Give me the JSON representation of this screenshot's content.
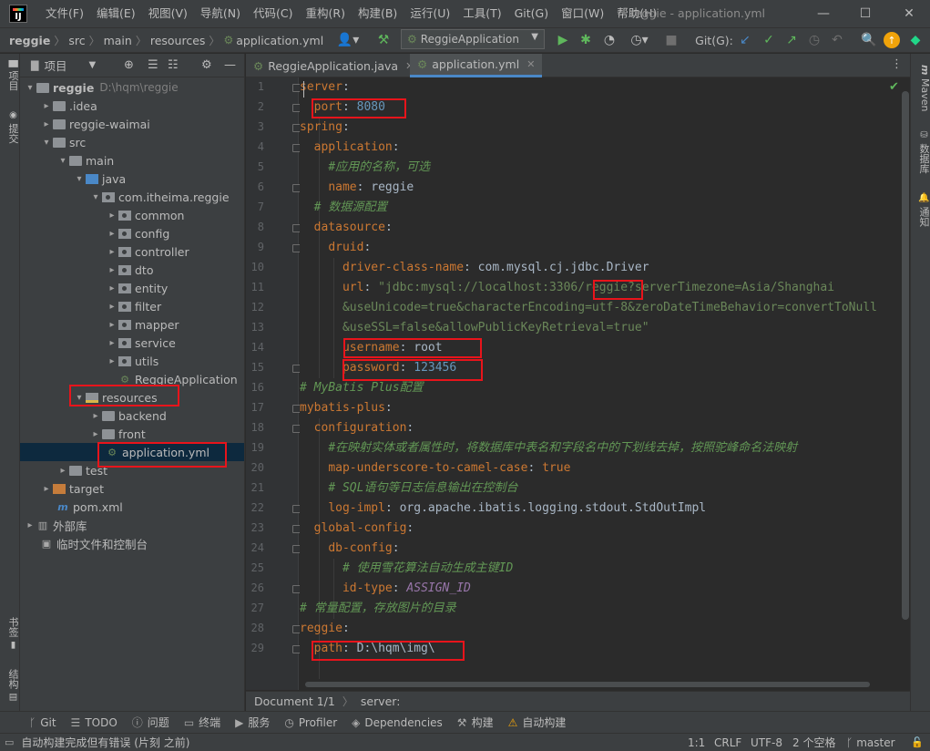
{
  "window": {
    "title": "reggie - application.yml",
    "logo_text": "IJ",
    "menu": [
      "文件(F)",
      "编辑(E)",
      "视图(V)",
      "导航(N)",
      "代码(C)",
      "重构(R)",
      "构建(B)",
      "运行(U)",
      "工具(T)",
      "Git(G)",
      "窗口(W)",
      "帮助(H)"
    ]
  },
  "navbar": {
    "breadcrumbs": [
      "reggie",
      "src",
      "main",
      "resources",
      "application.yml"
    ],
    "run_config": "ReggieApplication",
    "git_label": "Git(G):"
  },
  "left_strip": {
    "project": "项目",
    "commit": "提交",
    "bookmarks": "书签",
    "structure": "结构"
  },
  "right_strip": {
    "maven": "Maven",
    "database": "数据库",
    "notifications": "通知"
  },
  "project_panel": {
    "title": "项目",
    "tree": [
      {
        "label": "reggie",
        "hint": "D:\\hqm\\reggie"
      },
      {
        "label": ".idea"
      },
      {
        "label": "reggie-waimai"
      },
      {
        "label": "src"
      },
      {
        "label": "main"
      },
      {
        "label": "java"
      },
      {
        "label": "com.itheima.reggie"
      },
      {
        "label": "common"
      },
      {
        "label": "config"
      },
      {
        "label": "controller"
      },
      {
        "label": "dto"
      },
      {
        "label": "entity"
      },
      {
        "label": "filter"
      },
      {
        "label": "mapper"
      },
      {
        "label": "service"
      },
      {
        "label": "utils"
      },
      {
        "label": "ReggieApplication"
      },
      {
        "label": "resources"
      },
      {
        "label": "backend"
      },
      {
        "label": "front"
      },
      {
        "label": "application.yml"
      },
      {
        "label": "test"
      },
      {
        "label": "target"
      },
      {
        "label": "pom.xml"
      },
      {
        "label": "外部库"
      },
      {
        "label": "临时文件和控制台"
      }
    ]
  },
  "editor": {
    "tabs": [
      {
        "label": "ReggieApplication.java"
      },
      {
        "label": "application.yml"
      }
    ],
    "lines": [
      {
        "no": "1",
        "parts": [
          [
            "k",
            "server"
          ],
          [
            "t",
            ":"
          ]
        ]
      },
      {
        "no": "2",
        "parts": [
          [
            "t",
            "  "
          ],
          [
            "k",
            "port"
          ],
          [
            "t",
            ": "
          ],
          [
            "n",
            "8080"
          ]
        ]
      },
      {
        "no": "3",
        "parts": [
          [
            "k",
            "spring"
          ],
          [
            "t",
            ":"
          ]
        ]
      },
      {
        "no": "4",
        "parts": [
          [
            "t",
            "  "
          ],
          [
            "k",
            "application"
          ],
          [
            "t",
            ":"
          ]
        ]
      },
      {
        "no": "5",
        "parts": [
          [
            "t",
            "    "
          ],
          [
            "c",
            "#应用的名称，可选"
          ]
        ]
      },
      {
        "no": "6",
        "parts": [
          [
            "t",
            "    "
          ],
          [
            "k",
            "name"
          ],
          [
            "t",
            ": reggie"
          ]
        ]
      },
      {
        "no": "7",
        "parts": [
          [
            "t",
            "  "
          ],
          [
            "c",
            "# 数据源配置"
          ]
        ]
      },
      {
        "no": "8",
        "parts": [
          [
            "t",
            "  "
          ],
          [
            "k",
            "datasource"
          ],
          [
            "t",
            ":"
          ]
        ]
      },
      {
        "no": "9",
        "parts": [
          [
            "t",
            "    "
          ],
          [
            "k",
            "druid"
          ],
          [
            "t",
            ":"
          ]
        ]
      },
      {
        "no": "10",
        "parts": [
          [
            "t",
            "      "
          ],
          [
            "k",
            "driver-class-name"
          ],
          [
            "t",
            ": com.mysql.cj.jdbc.Driver"
          ]
        ]
      },
      {
        "no": "11",
        "parts": [
          [
            "t",
            "      "
          ],
          [
            "k",
            "url"
          ],
          [
            "t",
            ": "
          ],
          [
            "s",
            "\"jdbc:mysql://localhost:3306/reggie?serverTimezone=Asia/Shanghai"
          ]
        ]
      },
      {
        "no": "12",
        "parts": [
          [
            "t",
            "      "
          ],
          [
            "s",
            "&useUnicode=true&characterEncoding=utf-8&zeroDateTimeBehavior=convertToNull"
          ]
        ]
      },
      {
        "no": "13",
        "parts": [
          [
            "t",
            "      "
          ],
          [
            "s",
            "&useSSL=false&allowPublicKeyRetrieval=true\""
          ]
        ]
      },
      {
        "no": "14",
        "parts": [
          [
            "t",
            "      "
          ],
          [
            "k",
            "username"
          ],
          [
            "t",
            ": root"
          ]
        ]
      },
      {
        "no": "15",
        "parts": [
          [
            "t",
            "      "
          ],
          [
            "k",
            "password"
          ],
          [
            "t",
            ": "
          ],
          [
            "n",
            "123456"
          ]
        ]
      },
      {
        "no": "16",
        "parts": [
          [
            "c",
            "# MyBatis Plus配置"
          ]
        ]
      },
      {
        "no": "17",
        "parts": [
          [
            "k",
            "mybatis-plus"
          ],
          [
            "t",
            ":"
          ]
        ]
      },
      {
        "no": "18",
        "parts": [
          [
            "t",
            "  "
          ],
          [
            "k",
            "configuration"
          ],
          [
            "t",
            ":"
          ]
        ]
      },
      {
        "no": "19",
        "parts": [
          [
            "t",
            "    "
          ],
          [
            "c",
            "#在映射实体或者属性时，将数据库中表名和字段名中的下划线去掉，按照驼峰命名法映射"
          ]
        ]
      },
      {
        "no": "20",
        "parts": [
          [
            "t",
            "    "
          ],
          [
            "k",
            "map-underscore-to-camel-case"
          ],
          [
            "t",
            ": "
          ],
          [
            "k",
            "true"
          ]
        ]
      },
      {
        "no": "21",
        "parts": [
          [
            "t",
            "    "
          ],
          [
            "c",
            "# SQL语句等日志信息输出在控制台"
          ]
        ]
      },
      {
        "no": "22",
        "parts": [
          [
            "t",
            "    "
          ],
          [
            "k",
            "log-impl"
          ],
          [
            "t",
            ": org.apache.ibatis.logging.stdout.StdOutImpl"
          ]
        ]
      },
      {
        "no": "23",
        "parts": [
          [
            "t",
            "  "
          ],
          [
            "k",
            "global-config"
          ],
          [
            "t",
            ":"
          ]
        ]
      },
      {
        "no": "24",
        "parts": [
          [
            "t",
            "    "
          ],
          [
            "k",
            "db-config"
          ],
          [
            "t",
            ":"
          ]
        ]
      },
      {
        "no": "25",
        "parts": [
          [
            "t",
            "      "
          ],
          [
            "c",
            "# 使用雪花算法自动生成主键ID"
          ]
        ]
      },
      {
        "no": "26",
        "parts": [
          [
            "t",
            "      "
          ],
          [
            "k",
            "id-type"
          ],
          [
            "t",
            ": "
          ],
          [
            "v",
            "ASSIGN_ID"
          ]
        ]
      },
      {
        "no": "27",
        "parts": [
          [
            "c",
            "# 常量配置，存放图片的目录"
          ]
        ]
      },
      {
        "no": "28",
        "parts": [
          [
            "k",
            "reggie"
          ],
          [
            "t",
            ":"
          ]
        ]
      },
      {
        "no": "29",
        "parts": [
          [
            "t",
            "  "
          ],
          [
            "k",
            "path"
          ],
          [
            "t",
            ": D:\\hqm\\img\\"
          ]
        ]
      }
    ]
  },
  "editor_breadcrumb": [
    "Document 1/1",
    "server:"
  ],
  "tool_windows": [
    {
      "icon": "git-icon",
      "glyph": "ᚴ",
      "label": "Git"
    },
    {
      "icon": "todo-icon",
      "glyph": "☰",
      "label": "TODO"
    },
    {
      "icon": "problems-icon",
      "glyph": "ⓘ",
      "label": "问题"
    },
    {
      "icon": "terminal-icon",
      "glyph": "▭",
      "label": "终端"
    },
    {
      "icon": "services-icon",
      "glyph": "▶",
      "label": "服务"
    },
    {
      "icon": "profiler-icon",
      "glyph": "◷",
      "label": "Profiler"
    },
    {
      "icon": "dependencies-icon",
      "glyph": "◈",
      "label": "Dependencies"
    },
    {
      "icon": "build-icon",
      "glyph": "⚒",
      "label": "构建"
    },
    {
      "icon": "auto-build-icon",
      "glyph": "⚠",
      "label": "自动构建"
    }
  ],
  "status": {
    "message": "自动构建完成但有错误 (片刻 之前)",
    "position": "1:1",
    "line_sep": "CRLF",
    "encoding": "UTF-8",
    "indent": "2 个空格",
    "branch": "master"
  },
  "colors": {
    "highlight": "#e8141b",
    "accent": "#4a88c7",
    "keyword": "#cc7832",
    "string": "#6a8759",
    "comment": "#629755"
  }
}
